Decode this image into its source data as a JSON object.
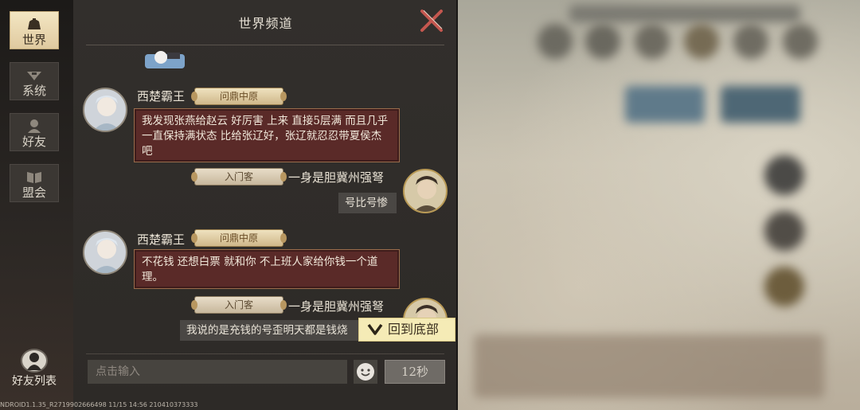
{
  "tabs": [
    {
      "label": "世界",
      "icon": "world-bell-icon",
      "active": true
    },
    {
      "label": "系统",
      "icon": "system-emblem-icon",
      "active": false
    },
    {
      "label": "好友",
      "icon": "friend-portrait-icon",
      "active": false
    },
    {
      "label": "盟会",
      "icon": "alliance-book-icon",
      "active": false
    }
  ],
  "friends_list_label": "好友列表",
  "channel_title": "世界频道",
  "messages": [
    {
      "name": "西楚霸王",
      "badge": "问鼎中原",
      "side": "left",
      "text": "我发现张燕给赵云 好厉害  上来 直接5层满 而且几乎一直保持满状态 比给张辽好，张辽就忍忍带夏侯杰吧"
    },
    {
      "name": "一身是胆冀州强弩",
      "badge": "入门客",
      "side": "right",
      "text": "号比号惨"
    },
    {
      "name": "西楚霸王",
      "badge": "问鼎中原",
      "side": "left",
      "text": "不花钱 还想白票  就和你 不上班人家给你钱一个道理。"
    },
    {
      "name": "一身是胆冀州强弩",
      "badge": "入门客",
      "side": "right",
      "text": "我说的是充钱的号歪明天都是钱烧"
    }
  ],
  "scroll_to_bottom_label": "回到底部",
  "input_placeholder": "点击输入",
  "send_cooldown": "12秒",
  "build_info": "NDROID1.1.35_R2719902666498 11/15 14:56 210410373333",
  "colors": {
    "active_tab": "#f3e6c2",
    "red_bubble": "#5a2a28",
    "gold_badge": "#e6d4a8",
    "scroll_button": "#f5ebb6"
  }
}
